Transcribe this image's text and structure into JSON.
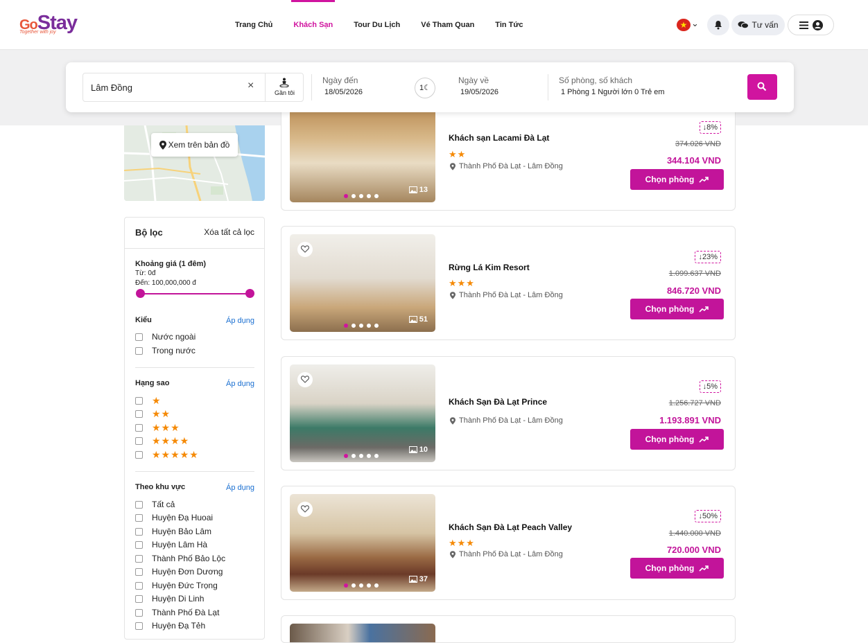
{
  "header": {
    "logo_main": "Stay",
    "logo_prefix": "Go",
    "logo_tagline": "Together with joy",
    "nav": [
      {
        "label": "Trang Chủ",
        "active": false
      },
      {
        "label": "Khách Sạn",
        "active": true
      },
      {
        "label": "Tour Du Lịch",
        "active": false
      },
      {
        "label": "Vé Tham Quan",
        "active": false
      },
      {
        "label": "Tin Tức",
        "active": false
      }
    ],
    "language_flag": "vietnam-flag",
    "consult_label": "Tư vấn",
    "accent_color": "#d0149f"
  },
  "search": {
    "destination": "Lâm Đồng",
    "near_me_label": "Gần tôi",
    "checkin_label": "Ngày đến",
    "checkin_value": "18/05/2026",
    "nights": "1",
    "checkout_label": "Ngày về",
    "checkout_value": "19/05/2026",
    "guests_label": "Số phòng, số khách",
    "guests_value": "1 Phòng 1 Người lớn 0 Trẻ em"
  },
  "sidebar": {
    "map_button_label": "Xem trên bản đồ",
    "filter_title": "Bộ lọc",
    "clear_all_label": "Xóa tất cả lọc",
    "price": {
      "title": "Khoảng giá (1 đêm)",
      "from": "Từ: 0đ",
      "to": "Đến: 100,000,000 đ",
      "range_fraction": [
        0,
        1
      ]
    },
    "type": {
      "title": "Kiểu",
      "apply": "Áp dụng",
      "options": [
        "Nước ngoài",
        "Trong nước"
      ]
    },
    "stars": {
      "title": "Hạng sao",
      "apply": "Áp dụng",
      "options": [
        "★",
        "★★",
        "★★★",
        "★★★★",
        "★★★★★"
      ]
    },
    "area": {
      "title": "Theo khu vực",
      "apply": "Áp dụng",
      "options": [
        "Tất cả",
        "Huyện Đạ Huoai",
        "Huyện Bảo Lâm",
        "Huyện Lâm Hà",
        "Thành Phố Bảo Lộc",
        "Huyện Đơn Dương",
        "Huyện Đức Trọng",
        "Huyện Di Linh",
        "Thành Phố Đà Lạt",
        "Huyện Đạ Tẻh"
      ]
    }
  },
  "hotels": [
    {
      "name": "Khách sạn Lacami Đà Lạt",
      "stars": "★★",
      "location": "Thành Phố Đà Lạt - Lâm Đồng",
      "discount": "↓8%",
      "old_price": "374.026 VND",
      "new_price": "344.104 VND",
      "image_count": "13",
      "button": "Chọn phòng"
    },
    {
      "name": "Rừng Lá Kim Resort",
      "stars": "★★★",
      "location": "Thành Phố Đà Lạt - Lâm Đồng",
      "discount": "↓23%",
      "old_price": "1.099.637 VND",
      "new_price": "846.720 VND",
      "image_count": "51",
      "button": "Chọn phòng"
    },
    {
      "name": "Khách Sạn Đà Lạt Prince",
      "stars": "",
      "location": "Thành Phố Đà Lạt - Lâm Đồng",
      "discount": "↓5%",
      "old_price": "1.256.727 VND",
      "new_price": "1.193.891 VND",
      "image_count": "10",
      "button": "Chọn phòng"
    },
    {
      "name": "Khách Sạn Đà Lạt Peach Valley",
      "stars": "★★★",
      "location": "Thành Phố Đà Lạt - Lâm Đồng",
      "discount": "↓50%",
      "old_price": "1.440.000 VND",
      "new_price": "720.000 VND",
      "image_count": "37",
      "button": "Chọn phòng"
    }
  ]
}
